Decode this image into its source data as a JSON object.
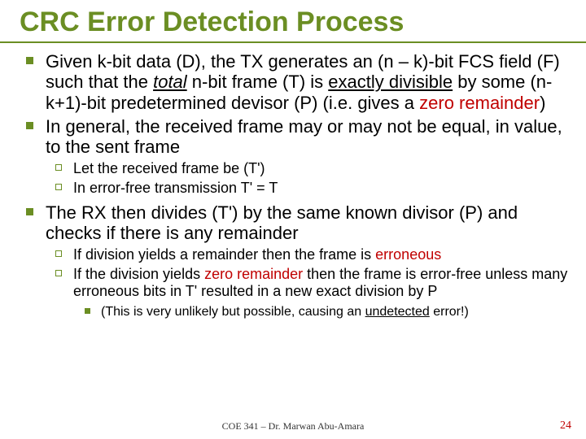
{
  "title": "CRC Error Detection Process",
  "bullets": [
    {
      "segments": [
        {
          "t": "Given k-bit data (D), the TX generates an (n – k)-bit FCS field (F) such that the "
        },
        {
          "t": "total",
          "cls": "ital under"
        },
        {
          "t": " n-bit frame (T) is "
        },
        {
          "t": "exactly divisible",
          "cls": "under"
        },
        {
          "t": " by some (n-k+1)-bit predetermined devisor (P) (i.e. gives a "
        },
        {
          "t": "zero remainder",
          "cls": "red"
        },
        {
          "t": ")"
        }
      ]
    },
    {
      "segments": [
        {
          "t": "In general, the received frame may or may not be equal, in value, to the sent frame"
        }
      ],
      "sub": [
        {
          "segments": [
            {
              "t": "Let the received frame be (T')"
            }
          ]
        },
        {
          "segments": [
            {
              "t": "In error-free transmission T' = T"
            }
          ]
        }
      ]
    },
    {
      "segments": [
        {
          "t": "The RX then divides (T') by the same known divisor (P) and checks if there is any remainder"
        }
      ],
      "sub": [
        {
          "segments": [
            {
              "t": "If division yields a remainder then the frame is "
            },
            {
              "t": "erroneous",
              "cls": "red"
            }
          ]
        },
        {
          "segments": [
            {
              "t": "If the division yields "
            },
            {
              "t": "zero remainder",
              "cls": "red"
            },
            {
              "t": " then the frame is error-free unless many erroneous bits in T' resulted in a new exact division by P"
            }
          ],
          "sub": [
            {
              "segments": [
                {
                  "t": "(This is very unlikely but possible, causing an "
                },
                {
                  "t": "undetected",
                  "cls": "under"
                },
                {
                  "t": " error!)"
                }
              ]
            }
          ]
        }
      ]
    }
  ],
  "footer": "COE 341 – Dr. Marwan Abu-Amara",
  "page": "24"
}
